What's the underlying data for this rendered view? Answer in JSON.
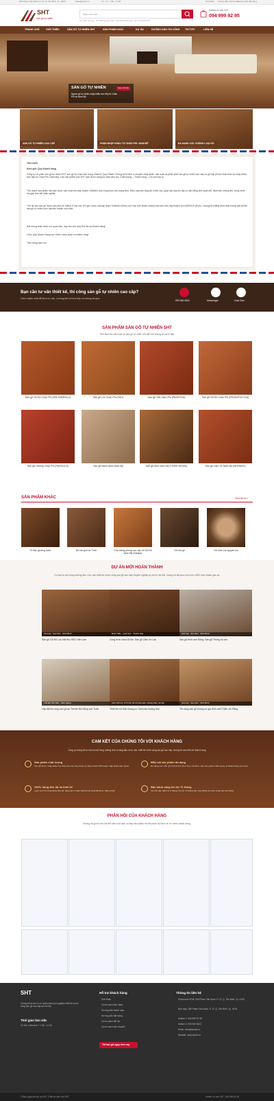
{
  "colors": {
    "brand_red": "#c8102e",
    "brand_brown": "#6b3a1f",
    "dark": "#2e2e2e"
  },
  "topbar": {
    "address": "185 Phạm Văn Đạnh, P. 12, Q. Tân Bình, Tp. HCM",
    "email": "hello@sanbt.vn",
    "hours": "T2 - T7 : 7:30 - 17:00",
    "links": [
      "Giới thiệu",
      "Hướng dẫn thanh toán",
      "Hướng dẫn đặt hàng"
    ]
  },
  "header": {
    "logo_text": "SHT",
    "logo_slogan": "Sàn gỗ tự nhiên",
    "search_placeholder": "Bạn cần tìm...",
    "quick_links": "Gỗ Căm Xe Lào · Gỗ Muồng Nam Mỹ · Gỗ Pachi Nam Mỹ · Gỗ Lim Châu Phi",
    "hotline_label": "Hotline tư vấn 24/7",
    "hotline_number": "094 999 92 95"
  },
  "nav": [
    "TRANG CHỦ",
    "GIỚI THIỆU",
    "SẢN GỖ TỰ NHIÊN SHT",
    "SẢN PHẨM KHÁC",
    "DỰ ÁN",
    "HƯỚNG DẪN THI CÔNG",
    "TIN TỨC",
    "LIÊN HỆ"
  ],
  "hero": {
    "title": "SÀN GỖ TỰ NHIÊN",
    "badge": "Xem chi tiết",
    "desc": "Nguồn gỗ tự nhiên nhập khẩu trực tiếp từ Châu Phi và Nam Mỹ"
  },
  "categories": [
    "SÀN GỖ TỰ NHIÊN CAO CẤP",
    "PHẢN NHẬP KHẨU TỪ CHÂU PHI / NAM MỸ",
    "ĐA DẠNG CÁC CHỦNG LOẠI GỖ"
  ],
  "letter": {
    "heading": "THƯ NGỎ",
    "greeting": "Kính gửi: Quý Khách hàng",
    "p1": "Công ty Cổ phần sàn gỗ tự nhiên SHT sơn gỗ tự chào trân trọng nhất tới Quý Khách! Chúng tôi là đơn vị chuyên nhập khẩu, sản xuất và phân phối sàn gỗ tự nhiên cao cấp và gỗ hộp (Được khai thác và nhập khẩu trực tiếp từ Châu Phi, Nam Mỹ). Các sản phẩm của SHT luôn được sàng lọc theo tiêu chí: Chất lượng – Thành công – Chi phí hợp lý.",
    "p2": "Thế mạnh sản phẩm sàn sàn được sàn xuất trên dây truyền HOMAG của Cộng hoà Liên bang Đức. Điều này làm tăng độ chính xác, giúp sàn sau khi lắp có sàn bằng khít tuyệt đối, đảm bảo chống ẩm, cong vênh khi gặp thời tiết khắc nghiệt.",
    "p3": "Thế hệ sàn sàn gỗ được sản phủ bề mặt từ 8 lớp sơn UV gốc nước của tập đoàn TreffertDi (Đức) và 2 lớp sơn khám chống mài mòn trên dây truyền sơn BURKLE (Đức). Chúng tôi khẳng định chất lượng sản phẩm sàn gỗ tự nhiên luôn đạt tiêu chuẩn cao nhất.",
    "p4": "Rất mong nhận được sự quan tâm, hợp tác của Quý Đối tác và Khách hàng!",
    "p5": "Chúc Quý Khách Hàng sức khỏe, hạnh phúc và thành công!",
    "sign": "Trân trọng cảm ơn!"
  },
  "consult": {
    "title": "Bạn cần tư vấn thiết kế, thi công sàn gỗ tự nhiên cao cấp?",
    "sub": "Cách nhanh nhất để được tư vấn, vui lòng kết nối trực tiếp với chúng tôi qua:",
    "phone_label": "090 949 0822",
    "messenger_label": "Messenger",
    "zalo_label": "Chat Zalo"
  },
  "products": {
    "title": "SẢN PHẨM SÀN GỖ TỰ NHIÊN SHT",
    "sub": "Mời Bạn tìm hiểu một số sản gỗ tự nhiên nổi bật của chúng tôi dưới đây",
    "items": [
      "Sàn gỗ Gõ Đỏ Châu Phi (908-908/ĐN/LZ)",
      "Sàn gỗ Lim Châu Phi (TALI)",
      "Sàn gỗ Trắc Nam Phi (PADROSA)",
      "Sàn gỗ Gõ Đỏ Châu Phi (PADAUFOLCDA)",
      "Sàn gỗ Hương Châu Phi (PADOUCK)",
      "Sàn gỗ Bạch xanh Nam Mỹ",
      "Sàn gỗ Mun Nam Mỹ (TIGER WOOD)",
      "Sàn gỗ Căm Xe Nam Mỹ (MORADO)"
    ]
  },
  "others": {
    "title": "SẢN PHẨM KHÁC",
    "more": "Xem tất cả »",
    "items": [
      "Tủ đầu giường Actor",
      "Bộ bàn ghế ăn Trinh",
      "Cửa thông phòng cao cấp Gỗ Gõ Đỏ Nam Mỹ (Sarapa)",
      "Gỗ nhà gỗ",
      "Gỗ Căm Lai nguyên lóu"
    ]
  },
  "projects": {
    "title": "DỰ ÁN MỚI HOÀN THÀNH",
    "sub": "Tự hào là một trong những đơn vị tư vấn thiết kế và thi công sàn gỗ cao cấp chuyên nghiệp uy tín tự Hà Nội, chúng tôi đã phục hơn hơn 1000 lượt khách gần xa.",
    "items": [
      {
        "tag": "Gia Lập · Gia Viên · Ninh Bình",
        "name": "Sàn gỗ Gõ Đỏ Lào biệt thự KĐC Him Lam"
      },
      {
        "tag": "Đình Triều · Quế Sơn · Thanh Hóa",
        "name": "Công trình chùa Di Đà: Sàn gỗ Căm Xe Lào"
      },
      {
        "tag": "Gia Lập · Gia Viên · Ninh Bình",
        "name": "Sàn gỗ trình anh Đông: Sàn gỗ Thông hộ bơi"
      },
      {
        "tag": "Thủ Đồ Tân Dân · Kiên Giang",
        "name": "Lắp đặt thi công sàn gỗ tại Theme Đà Nẵng anh Tuấn"
      },
      {
        "tag": "Căn N15-12, CT3 khu đô thị Gamuda, Hoàng Mai, Hà Nội",
        "name": "Thiết kế nội thất chung cư Gamuda Hoàng Mai"
      },
      {
        "tag": "Gia Lập · Gia Viên · Ninh Bình",
        "name": "Thi công sàn gỗ chung cư gia đình anh Thiện chị Hằng"
      }
    ]
  },
  "commit": {
    "title": "CAM KẾT CỦA CHÚNG TÔI VỚI KHÁCH HÀNG",
    "sub": "Công ty chúng tôi tự hào là một trong những đơn vị hàng đầu về tư vấn, thiết kế và thi công sàn gỗ cao cấp, chúng tôi cam kết với khách hàng",
    "items": [
      {
        "t": "Sản phẩm chất lượng",
        "d": "Sàn gỗ được nhập khẩu trực tiếp của nhà máy Công Ty Nhựa NAM TÂN hoặc nhập khẩu Nam Quốc"
      },
      {
        "t": "Mẫu mã sản phẩm đa dạng",
        "d": "Đa dạng các mẫu gỗ, tha hồ lựa chọn theo sở thích. Các sản phẩm chất lượng về khách hàng lựa chọn."
      },
      {
        "t": "100% đúng tiến độ và thiết kế",
        "d": "Luôn luôn thi công đúng tiến độ, đúng tiêu chuẩn thiết kế kỹ thuật đã được thống nhất"
      },
      {
        "t": "Bảo hành vàng lên tới 72 tháng",
        "d": "Chế độ bảo hành từ 6 tháng cho tới 72 tháng trên hợp đồng tùy theo từng loại sản phẩm"
      }
    ]
  },
  "feedback": {
    "title": "PHẢN HỒI CỦA KHÁCH HÀNG",
    "sub": "Không lời gì tốt hơn khi thể hiện một dịch vụ hay sản phẩm tốt bởi phản hồi thực tế từ chính khách hàng."
  },
  "footer": {
    "about": "Chúng tôi là đơn vị có nhiều năm kinh nghiệm thiết kế và thi công sàn gỗ cao cấp tại Hà Nội.",
    "hours_title": "Thời gian làm việc",
    "hours_text": "Từ thứ 2 đến thứ 7: 7:30 - 17:00",
    "guide_title": "Hỗ trợ khách hàng",
    "guide_items": [
      "Giới thiệu",
      "Chính sách bảo hành",
      "Hướng dẫn thanh toán",
      "Hướng dẫn đặt hàng",
      "Chính sách đổi trả",
      "Chính sách vận chuyển"
    ],
    "contact_title": "Thông tin liên hệ",
    "contact_items": [
      "Showroom HCM: 285 Phạm Văn Kạnh, P. 12, Q. Tân Bình, Tp. HCM",
      "Nhà máy: 285 Phạm Văn Kạnh, P. 12, Q. Tân Bình, Tp. HCM",
      "Hotline 1: 094 999 92 95",
      "Hotline 2: 090 949 0822",
      "Email: hello@sanbt.vn",
      "Website: www.sanbt.vn"
    ],
    "cta": "Tải báo giá ngay hôm nay",
    "copyright": "© Bản quyền thuộc về SHT. Thiết kế web bởi SHT",
    "hotline_footer": "Hotline tư vấn 24/7: 094 999 92 95"
  }
}
